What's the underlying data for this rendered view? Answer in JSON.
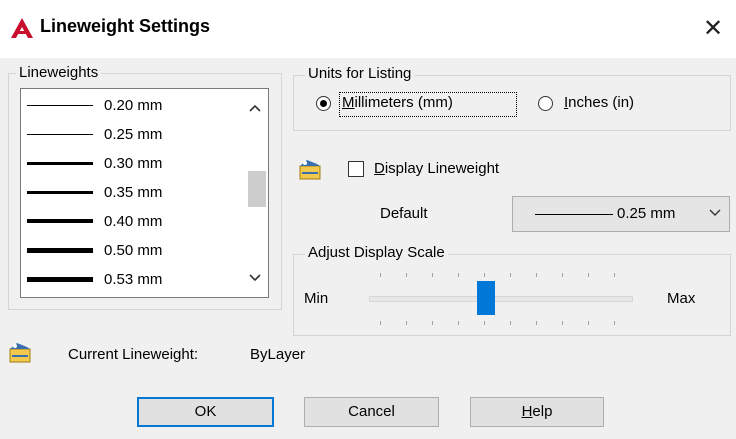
{
  "dialog": {
    "title": "Lineweight Settings",
    "close_glyph": "✕"
  },
  "lineweights": {
    "group_label": "Lineweights",
    "items": [
      {
        "label": "0.20 mm",
        "thickness": 1
      },
      {
        "label": "0.25 mm",
        "thickness": 1
      },
      {
        "label": "0.30 mm",
        "thickness": 3
      },
      {
        "label": "0.35 mm",
        "thickness": 3
      },
      {
        "label": "0.40 mm",
        "thickness": 4
      },
      {
        "label": "0.50 mm",
        "thickness": 5
      },
      {
        "label": "0.53 mm",
        "thickness": 5
      }
    ],
    "scroll_up_glyph": "▲",
    "scroll_down_glyph": "▼"
  },
  "units": {
    "group_label": "Units for Listing",
    "millimeters_label": "Millimeters (mm)",
    "inches_label": "Inches (in)",
    "selected": "millimeters"
  },
  "display": {
    "checkbox_label": "Display Lineweight",
    "checked": false,
    "default_label": "Default",
    "default_value": "0.25 mm",
    "dropdown_glyph": "∨"
  },
  "scale": {
    "group_label": "Adjust Display Scale",
    "min_label": "Min",
    "max_label": "Max",
    "value_fraction": 0.44
  },
  "current": {
    "label": "Current Lineweight:",
    "value": "ByLayer"
  },
  "buttons": {
    "ok": "OK",
    "cancel": "Cancel",
    "help": "Help"
  },
  "colors": {
    "accent": "#0078d7",
    "logo": "#c8102e"
  }
}
